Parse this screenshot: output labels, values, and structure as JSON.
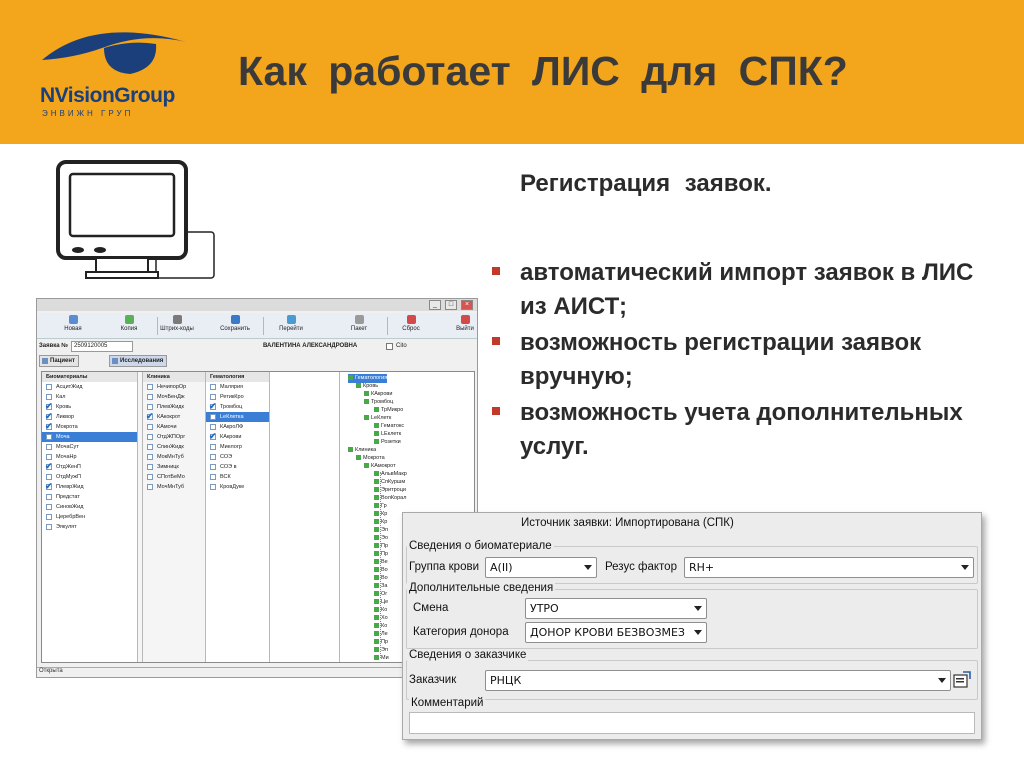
{
  "header": {
    "title": "Как работает ЛИС для СПК?",
    "logo_name": "NVisionGroup",
    "logo_sub": "ЭНВИЖН ГРУП",
    "bg_color": "#f3a51b"
  },
  "slide": {
    "subtitle": "Регистрация заявок.",
    "bullets": [
      {
        "text": "автоматический импорт заявок в ЛИС из АИСТ;"
      },
      {
        "text": "возможность регистрации заявок вручную;"
      },
      {
        "text": "возможность учета дополнительных услуг."
      }
    ],
    "bullet_color": "#c0392b"
  },
  "app": {
    "toolbar": [
      {
        "label": "Новая",
        "icon": "new-icon"
      },
      {
        "label": "Копия",
        "icon": "copy-icon"
      },
      {
        "label": "Штрих-коды",
        "icon": "barcode-icon"
      },
      {
        "label": "Сохранить",
        "icon": "save-icon"
      },
      {
        "label": "Перейти",
        "icon": "goto-icon"
      },
      {
        "label": "Пакет",
        "icon": "package-icon"
      },
      {
        "label": "Сброс",
        "icon": "reset-icon"
      },
      {
        "label": "Выйти",
        "icon": "exit-icon"
      }
    ],
    "order_label": "Заявка №",
    "order_number": "2509120005",
    "patient_name": "ВАЛЕНТИНА АЛЕКСАНДРОВНА",
    "cito_label": "Cito",
    "tabs": [
      {
        "label": "Пациент"
      },
      {
        "label": "Исследования"
      }
    ],
    "biomaterials": {
      "header": "Биоматериалы",
      "items": [
        {
          "label": "АсцитЖид",
          "checked": false,
          "selected": false
        },
        {
          "label": "Кал",
          "checked": false,
          "selected": false
        },
        {
          "label": "Кровь",
          "checked": true,
          "selected": false
        },
        {
          "label": "Ликвор",
          "checked": true,
          "selected": false
        },
        {
          "label": "Мокрота",
          "checked": true,
          "selected": false
        },
        {
          "label": "Моча",
          "checked": false,
          "selected": true
        },
        {
          "label": "МочаСут",
          "checked": false,
          "selected": false
        },
        {
          "label": "МочаНр",
          "checked": false,
          "selected": false
        },
        {
          "label": "ОтдЖенП",
          "checked": true,
          "selected": false
        },
        {
          "label": "ОтдМужП",
          "checked": false,
          "selected": false
        },
        {
          "label": "ПлеврЖид",
          "checked": true,
          "selected": false
        },
        {
          "label": "Предстат",
          "checked": false,
          "selected": false
        },
        {
          "label": "СиновЖид",
          "checked": false,
          "selected": false
        },
        {
          "label": "ЦеребрВен",
          "checked": false,
          "selected": false
        },
        {
          "label": "Эякулят",
          "checked": false,
          "selected": false
        }
      ]
    },
    "clinic": {
      "header": "Клиника",
      "items": [
        {
          "label": "НечипорОр",
          "checked": false,
          "selected": false
        },
        {
          "label": "МочБенДж",
          "checked": false,
          "selected": false
        },
        {
          "label": "ПлевЖидк",
          "checked": false,
          "selected": false
        },
        {
          "label": "КАкокрот",
          "checked": true,
          "selected": false
        },
        {
          "label": "КАмочи",
          "checked": false,
          "selected": false
        },
        {
          "label": "ОтдЖПОрг",
          "checked": false,
          "selected": false
        },
        {
          "label": "СпинЖидк",
          "checked": false,
          "selected": false
        },
        {
          "label": "МокМнТуб",
          "checked": false,
          "selected": false
        },
        {
          "label": "Зимницк",
          "checked": false,
          "selected": false
        },
        {
          "label": "СПотБеМо",
          "checked": false,
          "selected": false
        },
        {
          "label": "МочМнТуб",
          "checked": false,
          "selected": false
        }
      ]
    },
    "hematology": {
      "header": "Гематология",
      "items": [
        {
          "label": "Малярия",
          "checked": false,
          "selected": false
        },
        {
          "label": "РетикКро",
          "checked": false,
          "selected": false
        },
        {
          "label": "Тромбоц",
          "checked": true,
          "selected": false
        },
        {
          "label": "LeКлетка",
          "checked": false,
          "selected": true
        },
        {
          "label": "КАкроЛФ",
          "checked": false,
          "selected": false
        },
        {
          "label": "КАкрови",
          "checked": true,
          "selected": false
        },
        {
          "label": "Миелогр",
          "checked": false,
          "selected": false
        },
        {
          "label": "СОЭ",
          "checked": false,
          "selected": false
        },
        {
          "label": "СОЭ в",
          "checked": false,
          "selected": false
        },
        {
          "label": "ВСК",
          "checked": false,
          "selected": false
        },
        {
          "label": "КровДуке",
          "checked": false,
          "selected": false
        }
      ]
    },
    "tree": [
      {
        "label": "Гематология",
        "level": 0,
        "hl": true
      },
      {
        "label": "Кровь",
        "level": 1,
        "hl": false
      },
      {
        "label": "КАкрови",
        "level": 2,
        "hl": false
      },
      {
        "label": "Тромбоц",
        "level": 2,
        "hl": false
      },
      {
        "label": "ТрМикро",
        "level": 3,
        "hl": false
      },
      {
        "label": "LeКлетк",
        "level": 2,
        "hl": false
      },
      {
        "label": "Гематокс",
        "level": 3,
        "hl": false
      },
      {
        "label": "LEклетк",
        "level": 3,
        "hl": false
      },
      {
        "label": "Розетки",
        "level": 3,
        "hl": false
      },
      {
        "label": "Клиника",
        "level": 0,
        "hl": false
      },
      {
        "label": "Мокрота",
        "level": 1,
        "hl": false
      },
      {
        "label": "КАмокрот",
        "level": 2,
        "hl": false
      },
      {
        "label": "АльвМакр",
        "level": 3,
        "hl": false
      },
      {
        "label": "СпКуршм",
        "level": 3,
        "hl": false
      },
      {
        "label": "Эритроци",
        "level": 3,
        "hl": false
      },
      {
        "label": "ВолКорал",
        "level": 3,
        "hl": false
      },
      {
        "label": "Гр",
        "level": 3,
        "hl": false
      },
      {
        "label": "Кр",
        "level": 3,
        "hl": false
      },
      {
        "label": "Кр",
        "level": 3,
        "hl": false
      },
      {
        "label": "Эл",
        "level": 3,
        "hl": false
      },
      {
        "label": "Эо",
        "level": 3,
        "hl": false
      },
      {
        "label": "Пр",
        "level": 3,
        "hl": false
      },
      {
        "label": "Пр",
        "level": 3,
        "hl": false
      },
      {
        "label": "Ве",
        "level": 3,
        "hl": false
      },
      {
        "label": "Во",
        "level": 3,
        "hl": false
      },
      {
        "label": "Во",
        "level": 3,
        "hl": false
      },
      {
        "label": "За",
        "level": 3,
        "hl": false
      },
      {
        "label": "Ог",
        "level": 3,
        "hl": false
      },
      {
        "label": "Це",
        "level": 3,
        "hl": false
      },
      {
        "label": "Ко",
        "level": 3,
        "hl": false
      },
      {
        "label": "Хо",
        "level": 3,
        "hl": false
      },
      {
        "label": "Ко",
        "level": 3,
        "hl": false
      },
      {
        "label": "Ле",
        "level": 3,
        "hl": false
      },
      {
        "label": "Пр",
        "level": 3,
        "hl": false
      },
      {
        "label": "Эп",
        "level": 3,
        "hl": false
      },
      {
        "label": "Ми",
        "level": 3,
        "hl": false
      }
    ],
    "status": "Открыта"
  },
  "dialog": {
    "source_label": "Источник заявки: Импортирована (СПК)",
    "bio_group": "Сведения о биоматериале",
    "blood_group_label": "Группа крови",
    "blood_group_value": "A(II)",
    "rh_label": "Резус фактор",
    "rh_value": "RH+",
    "extra_group": "Дополнительные сведения",
    "shift_label": "Смена",
    "shift_value": "УТРО",
    "donor_cat_label": "Категория донора",
    "donor_cat_value": "ДОНОР КРОВИ БЕЗВОЗМЕЗ",
    "customer_group": "Сведения о заказчике",
    "customer_label": "Заказчик",
    "customer_value": "РНЦК",
    "comment_label": "Комментарий",
    "comment_value": ""
  }
}
